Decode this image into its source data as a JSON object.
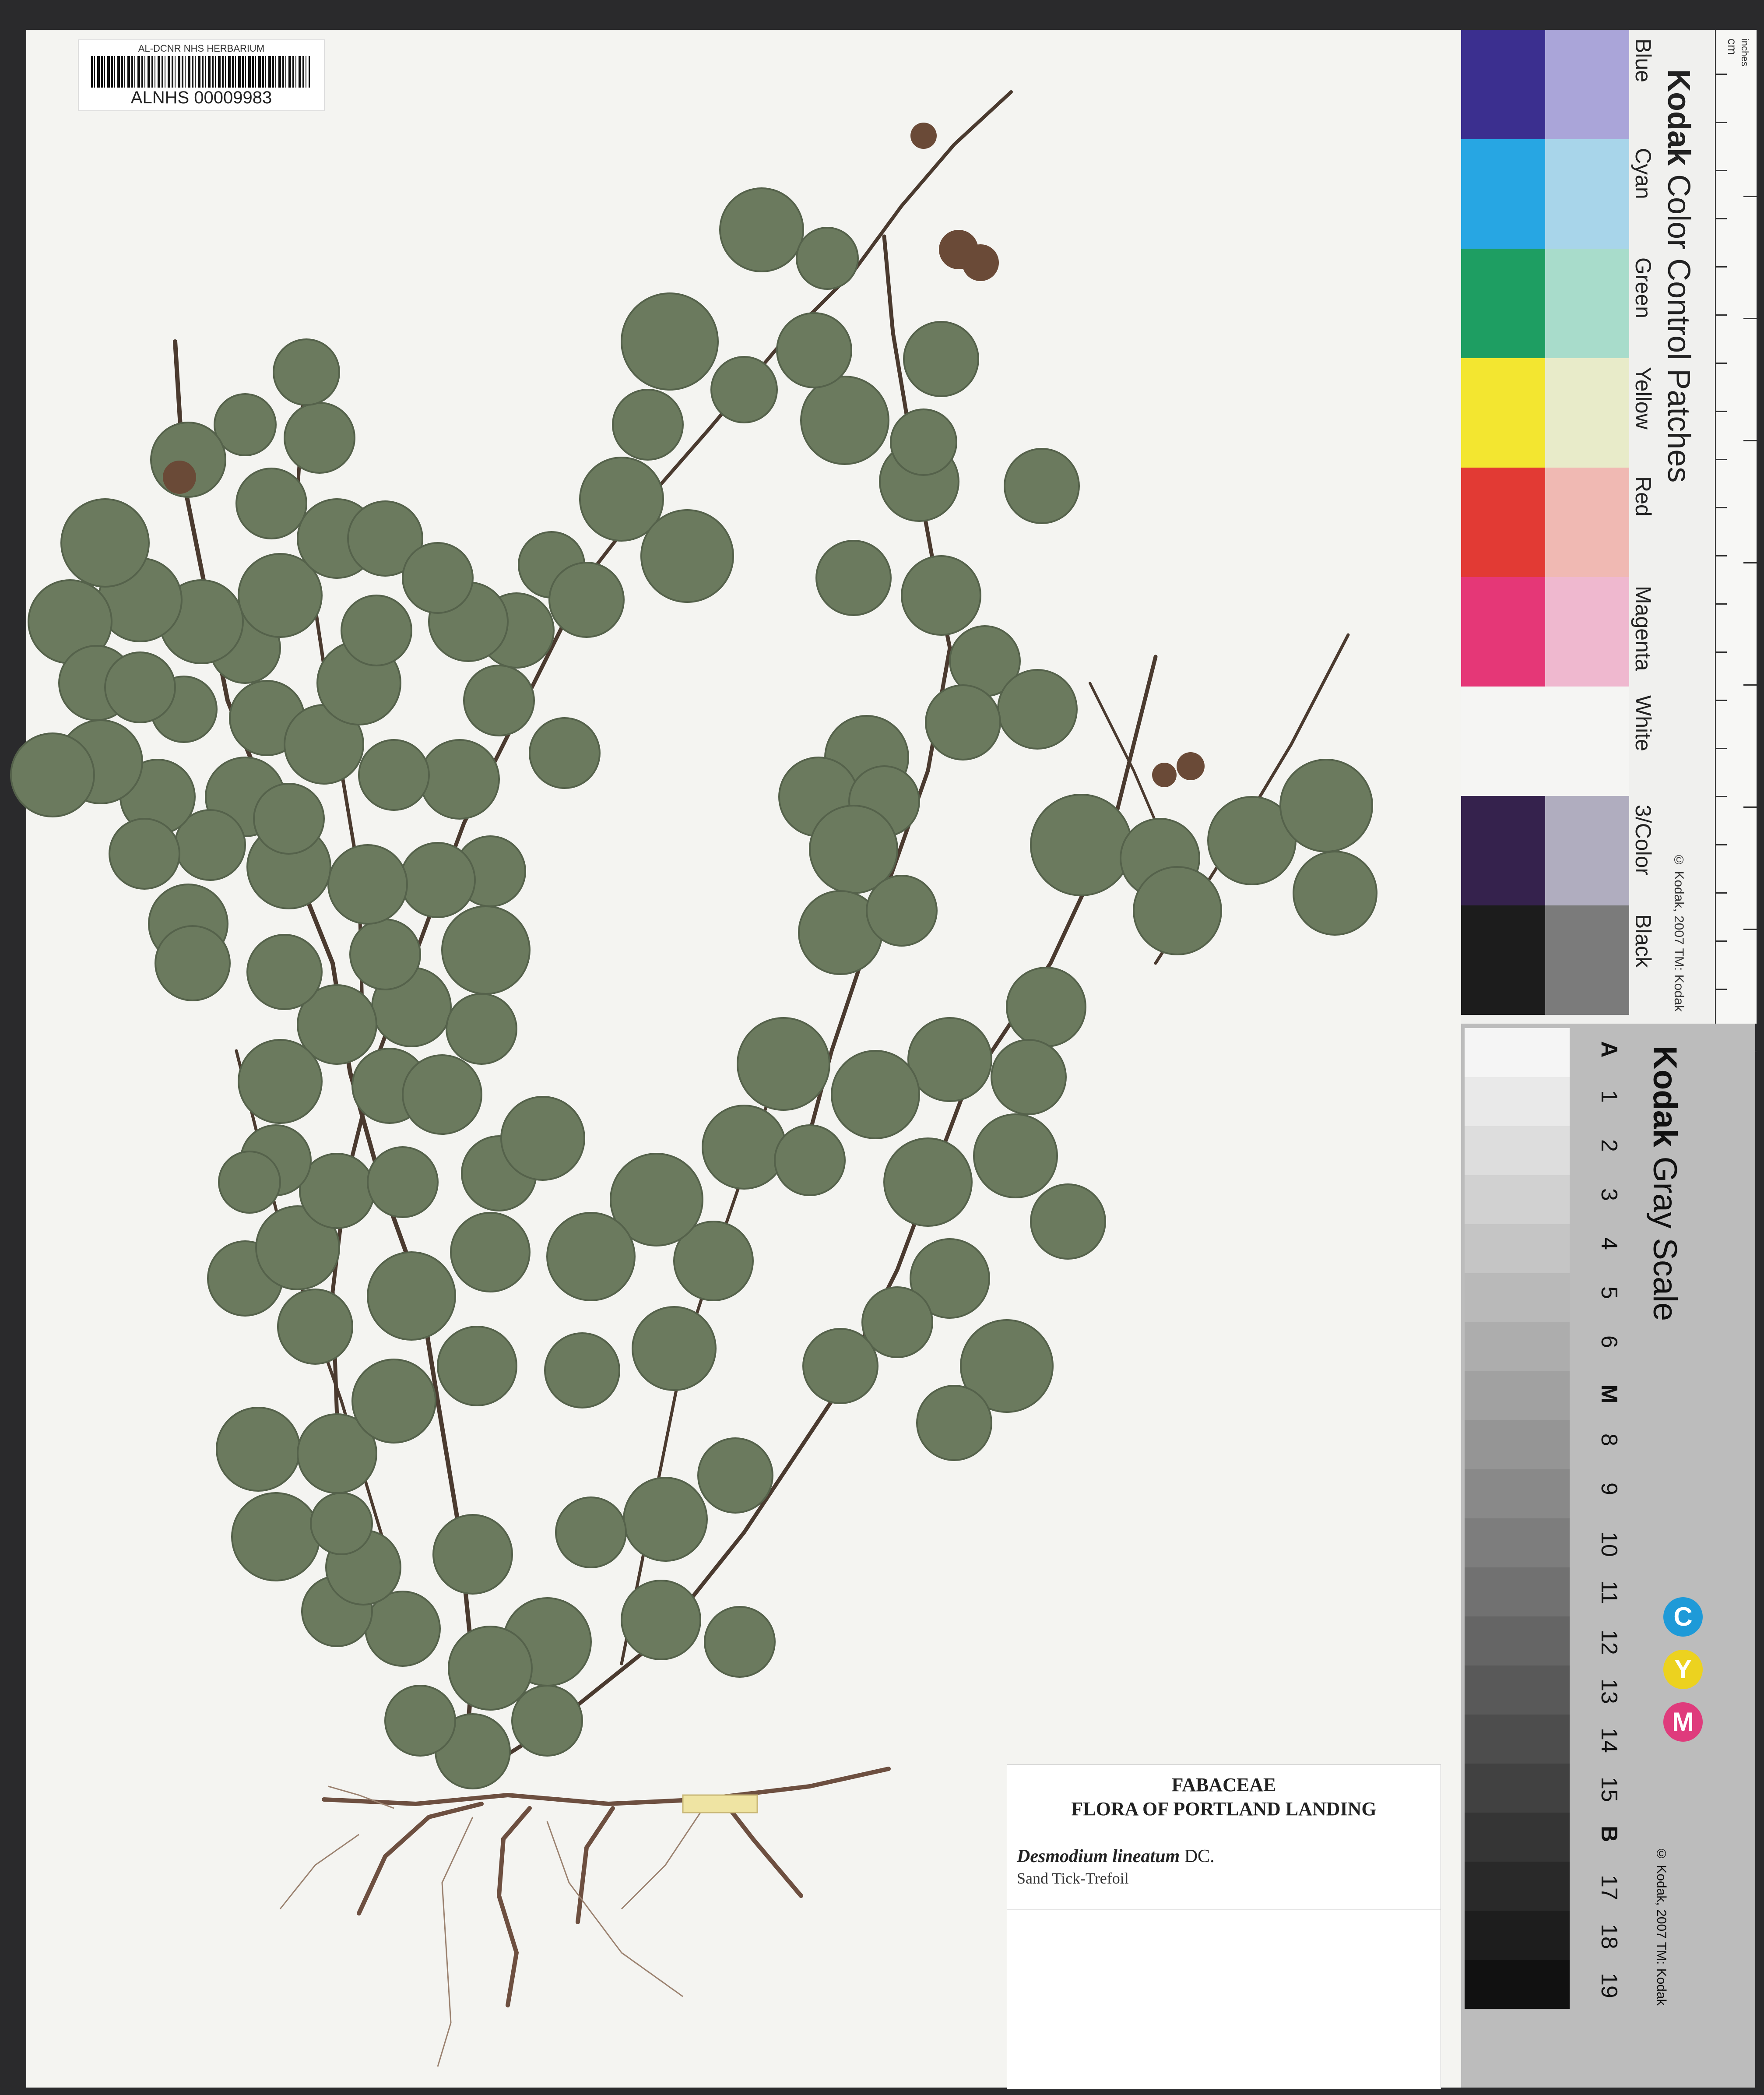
{
  "barcode": {
    "institution": "AL-DCNR NHS HERBARIUM",
    "number": "ALNHS 00009983"
  },
  "specimen_label": {
    "family": "FABACEAE",
    "flora": "FLORA OF PORTLAND LANDING",
    "scientific_name": "Desmodium lineatum",
    "author": "DC.",
    "common_name": "Sand Tick-Trefoil"
  },
  "color_card": {
    "title_brand": "Kodak",
    "title_rest": "Color Control Patches",
    "patches": [
      {
        "name": "Blue",
        "color": "#3b2f8f",
        "tint": "#aaa5d9"
      },
      {
        "name": "Cyan",
        "color": "#27a6e3",
        "tint": "#a8d5ea"
      },
      {
        "name": "Green",
        "color": "#1e9e62",
        "tint": "#a8dccb"
      },
      {
        "name": "Yellow",
        "color": "#f3e630",
        "tint": "#e8ebc9"
      },
      {
        "name": "Red",
        "color": "#e23a34",
        "tint": "#f0b9b3"
      },
      {
        "name": "Magenta",
        "color": "#e53777",
        "tint": "#efb8cf"
      },
      {
        "name": "White",
        "color": "#f5f5f3",
        "tint": "#f5f5f3"
      },
      {
        "name": "3/Color",
        "color": "#35224d",
        "tint": "#b0adbf"
      },
      {
        "name": "Black",
        "color": "#1c1c1c",
        "tint": "#7b7b7b"
      }
    ],
    "copyright": "© Kodak, 2007  TM: Kodak",
    "ruler_unit_cm": "cm",
    "ruler_unit_in": "inches"
  },
  "gray_card": {
    "title_brand": "Kodak",
    "title_rest": "Gray Scale",
    "steps": [
      "A",
      "1",
      "2",
      "3",
      "4",
      "5",
      "6",
      "M",
      "8",
      "9",
      "10",
      "11",
      "12",
      "13",
      "14",
      "15",
      "B",
      "17",
      "18",
      "19"
    ],
    "cym": [
      {
        "letter": "C",
        "color": "#1e9ad8"
      },
      {
        "letter": "Y",
        "color": "#ecd21f"
      },
      {
        "letter": "M",
        "color": "#df3b7c"
      }
    ],
    "copyright": "© Kodak, 2007  TM: Kodak"
  }
}
